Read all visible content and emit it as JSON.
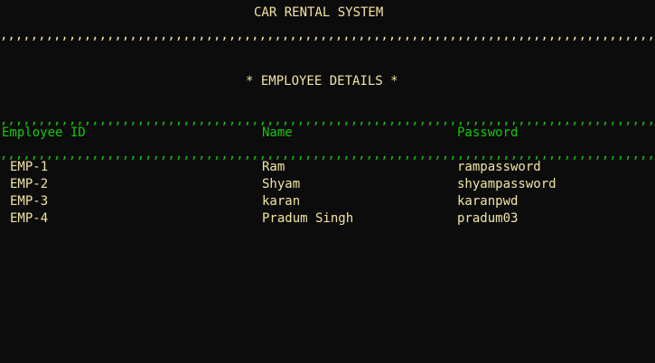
{
  "title": "CAR RENTAL SYSTEM",
  "separator_yellow": ",,,,,,,,,,,,,,,,,,,,,,,,,,,,,,,,,,,,,,,,,,,,,,,,,,,,,,,,,,,,,,,,,,,,,,,,,,,,,,,,,,,,,,,,,,,,,,,,,,,,,,,,",
  "subtitle": "* EMPLOYEE DETAILS *",
  "separator_green": ",,,,,,,,,,,,,,,,,,,,,,,,,,,,,,,,,,,,,,,,,,,,,,,,,,,,,,,,,,,,,,,,,,,,,,,,,,,,,,,,,,,,,,,,,,,,,,,,,,,,,,,,",
  "table": {
    "headers": [
      "Employee ID",
      "Name",
      "Password"
    ],
    "rows": [
      [
        "EMP-1",
        "Ram",
        "rampassword"
      ],
      [
        "EMP-2",
        "Shyam",
        "shyampassword"
      ],
      [
        "EMP-3",
        "karan",
        "karanpwd"
      ],
      [
        "EMP-4",
        "Pradum Singh",
        "pradum03"
      ]
    ]
  },
  "colors": {
    "background": "#0c0c0c",
    "text": "#f2e4a2",
    "header": "#16c60c"
  }
}
